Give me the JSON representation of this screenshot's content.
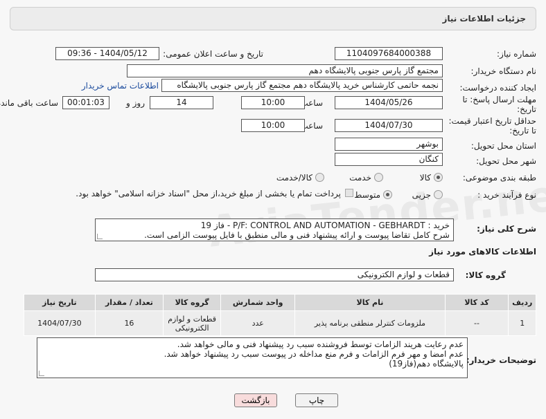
{
  "header": {
    "title": "جزئیات اطلاعات نیاز"
  },
  "fields": {
    "need_number_label": "شماره نیاز:",
    "need_number": "1104097684000388",
    "announce_label": "تاریخ و ساعت اعلان عمومی:",
    "announce_value": "1404/05/12 - 09:36",
    "buyer_org_label": "نام دستگاه خریدار:",
    "buyer_org": "مجتمع گاز پارس جنوبی  پالایشگاه دهم",
    "requester_label": "ایجاد کننده درخواست:",
    "requester": "نجمه حاتمی کارشناس خرید پالایشگاه دهم  مجتمع گاز پارس جنوبی  پالایشگاه",
    "contact_link": "اطلاعات تماس خریدار",
    "deadline_label": "مهلت ارسال پاسخ: تا",
    "deadline_label2": "تاریخ:",
    "deadline_date": "1404/05/26",
    "time_label": "ساعت",
    "deadline_time": "10:00",
    "days_value": "14",
    "days_label": "روز و",
    "remaining_time": "00:01:03",
    "remaining_label": "ساعت باقی مانده",
    "validity_label": "حداقل تاریخ اعتبار قیمت:",
    "validity_label2": "تا تاریخ:",
    "validity_date": "1404/07/30",
    "validity_time": "10:00",
    "province_label": "استان محل تحویل:",
    "province": "بوشهر",
    "city_label": "شهر محل تحویل:",
    "city": "کنگان",
    "category_label": "طبقه بندی موضوعی:",
    "category_options": [
      "کالا",
      "خدمت",
      "کالا/خدمت"
    ],
    "process_label": "نوع فرآیند خرید :",
    "process_options": [
      "جزیی",
      "متوسط"
    ],
    "payment_note": "پرداخت تمام یا بخشی از مبلغ خرید،از محل \"اسناد خزانه اسلامی\" خواهد بود.",
    "desc_label": "شرح کلی نیاز:",
    "desc_line1": "خرید : P/F: CONTROL AND AUTOMATION - GEBHARDT - فاز 19",
    "desc_line2": "شرح کامل تقاضا پیوست و ارائه پیشنهاد فنی و مالی منطبق با فایل پیوست الزامی است."
  },
  "goods": {
    "section_title": "اطلاعات کالاهای مورد نیاز",
    "group_label": "گروه کالا:",
    "group_value": "قطعات و لوازم الکترونیکی",
    "columns": [
      "ردیف",
      "کد کالا",
      "نام کالا",
      "واحد شمارش",
      "گروه کالا",
      "تعداد / مقدار",
      "تاریخ نیاز"
    ],
    "rows": [
      {
        "row": "1",
        "code": "--",
        "name": "ملزومات کنترلر منطقی برنامه پذیر",
        "unit": "عدد",
        "group": "قطعات و لوازم الکترونیکی",
        "qty": "16",
        "date": "1404/07/30"
      }
    ]
  },
  "buyer_notes": {
    "label": "توضیحات خریدار:",
    "lines": [
      "عدم رعایت هریند الزامات توسط فروشنده سبب رد پیشنهاد فنی و مالی خواهد شد.",
      "عدم امضا و مهر فرم الزامات و فرم منع مداخله در پیوست سبب رد پیشنهاد خواهد شد.",
      "پالایشگاه دهم(فاز19)"
    ]
  },
  "buttons": {
    "print": "چاپ",
    "back": "بازگشت"
  },
  "watermark": "AriaTender.neT",
  "colors": {
    "link": "#1a4a9c",
    "back_button": "#f8dcdc",
    "print_button": "#f2f2f2"
  }
}
